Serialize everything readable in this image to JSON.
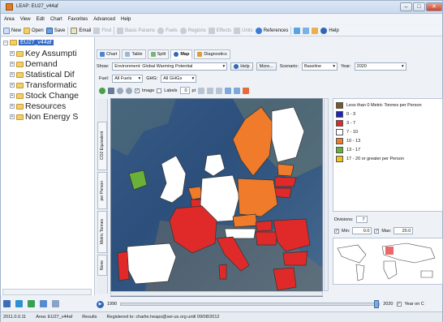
{
  "window": {
    "title": "LEAP: EU27_v44af"
  },
  "menu": [
    "Area",
    "View",
    "Edit",
    "Chart",
    "Favorites",
    "Advanced",
    "Help"
  ],
  "toolbar": [
    {
      "label": "New",
      "icon": "new-icon",
      "enabled": true
    },
    {
      "label": "Open",
      "icon": "open-icon",
      "enabled": true
    },
    {
      "label": "Save",
      "icon": "save-icon",
      "enabled": true
    },
    {
      "label": "Email",
      "icon": "email-icon",
      "enabled": true
    },
    {
      "label": "Find",
      "icon": "find-icon",
      "enabled": false
    },
    {
      "label": "Basic Params",
      "icon": "params-icon",
      "enabled": false
    },
    {
      "label": "Fuels",
      "icon": "fuels-icon",
      "enabled": false
    },
    {
      "label": "Regions",
      "icon": "regions-icon",
      "enabled": false
    },
    {
      "label": "Effects",
      "icon": "effects-icon",
      "enabled": false
    },
    {
      "label": "Units",
      "icon": "units-icon",
      "enabled": false
    },
    {
      "label": "References",
      "icon": "references-icon",
      "enabled": true
    },
    {
      "label": "Help",
      "icon": "help-icon",
      "enabled": true
    }
  ],
  "tree": {
    "root": "EU27_v44af",
    "items": [
      "Key Assumpti",
      "Demand",
      "Statistical Dif",
      "Transformatic",
      "Stock Change",
      "Resources",
      "Non Energy S"
    ]
  },
  "view_tabs": [
    "Chart",
    "Table",
    "Split",
    "Map",
    "Diagnostics"
  ],
  "controls": {
    "show_label": "Show:",
    "show_value": "Environment: Global Warming Potential",
    "help_btn": "Help",
    "more_btn": "More...",
    "scenario_label": "Scenario:",
    "scenario_value": "Baseline",
    "year_label": "Year:",
    "year_value": "2020",
    "fuel_label": "Fuel:",
    "fuel_value": "All Fuels",
    "ghg_label": "GHG:",
    "ghg_value": "All GHGs",
    "image_label": "Image",
    "labels_label": "Labels",
    "labels_size": "0",
    "labels_unit": "pt"
  },
  "side_tabs": [
    "CO2 Equivalent",
    "per Person",
    "Metric Tonnes",
    "None"
  ],
  "legend": [
    {
      "label": "Less than 0  Metric Tonnes per Person",
      "color": "#7a5a1e"
    },
    {
      "label": "0 - 3",
      "color": "#2323b8"
    },
    {
      "label": "3 - 7",
      "color": "#e02a2a"
    },
    {
      "label": "7 - 10",
      "color": "#ffffff"
    },
    {
      "label": "10 - 13",
      "color": "#f07b2a"
    },
    {
      "label": "13 - 17",
      "color": "#6ab13a"
    },
    {
      "label": "17 - 20 or greater per Person",
      "color": "#f2c318"
    }
  ],
  "divisions": {
    "label": "Divisions:",
    "value": "7"
  },
  "minmax": {
    "min_label": "Min:",
    "min_value": "0.0",
    "max_label": "Max:",
    "max_value": "20.0"
  },
  "timeline": {
    "start": "1990",
    "end": "2020",
    "option": "Year on C",
    "position": 1.0
  },
  "status": {
    "version": "2011.0.0.11",
    "area": "Area: EU27_v44af",
    "results": "Results",
    "registered": "Registered to: charlie.heaps@sei-us.org until 09/08/2012"
  }
}
